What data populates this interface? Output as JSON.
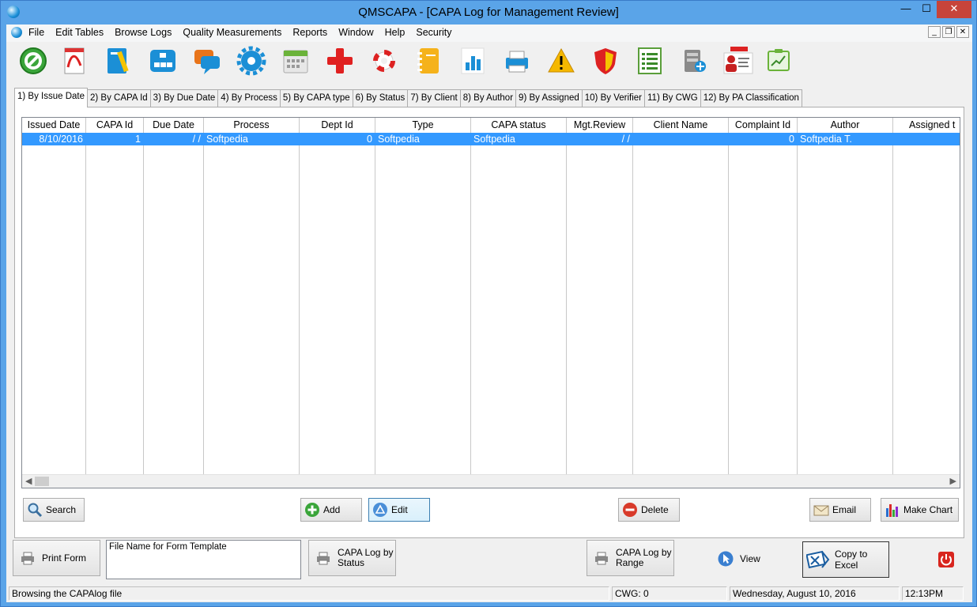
{
  "window": {
    "title": "QMSCAPA - [CAPA Log for Management Review]",
    "min": "—",
    "max": "☐",
    "close": "✕"
  },
  "mdi": {
    "min": "_",
    "restore": "❐",
    "close": "✕"
  },
  "menu": [
    "File",
    "Edit Tables",
    "Browse Logs",
    "Quality Measurements",
    "Reports",
    "Window",
    "Help",
    "Security"
  ],
  "toolbar_icons": [
    "cancel-icon",
    "pdf-icon",
    "edit-document-icon",
    "network-icon",
    "chat-icon",
    "settings-gear-icon",
    "calendar-icon",
    "add-plus-icon",
    "lifebuoy-icon",
    "notebook-icon",
    "bar-chart-icon",
    "printer-icon",
    "warning-icon",
    "shield-icon",
    "checklist-icon",
    "server-add-icon",
    "business-card-icon",
    "clipboard-chart-icon"
  ],
  "tabs": [
    "1) By Issue Date",
    "2) By CAPA Id",
    "3) By Due Date",
    "4) By Process",
    "5) By CAPA type",
    "6) By Status",
    "7) By Client",
    "8) By Author",
    "9) By Assigned",
    "10) By Verifier",
    "11) By CWG",
    "12) By PA Classification"
  ],
  "grid": {
    "columns": [
      "Issued Date",
      "CAPA Id",
      "Due Date",
      "Process",
      "Dept Id",
      "Type",
      "CAPA status",
      "Mgt.Review",
      "Client Name",
      "Complaint Id",
      "Author",
      "Assigned t"
    ],
    "rows": [
      [
        "8/10/2016",
        "1",
        "/  /",
        "Softpedia",
        "0",
        "Softpedia",
        "Softpedia",
        "/  /",
        "",
        "0",
        "Softpedia T.",
        ""
      ]
    ]
  },
  "buttons": {
    "search": "Search",
    "add": "Add",
    "edit": "Edit",
    "delete": "Delete",
    "email": "Email",
    "make_chart": "Make Chart"
  },
  "bottom": {
    "print_form": "Print Form",
    "form_template_label": "File Name for Form Template",
    "capa_by_status_1": "CAPA Log by",
    "capa_by_status_2": "Status",
    "capa_by_range_1": "CAPA Log by",
    "capa_by_range_2": "Range",
    "view": "View",
    "copy_to_excel": "Copy to Excel"
  },
  "status": {
    "message": "Browsing the CAPAlog file",
    "cwg": "CWG: 0",
    "date": "Wednesday, August 10, 2016",
    "time": "12:13PM"
  }
}
